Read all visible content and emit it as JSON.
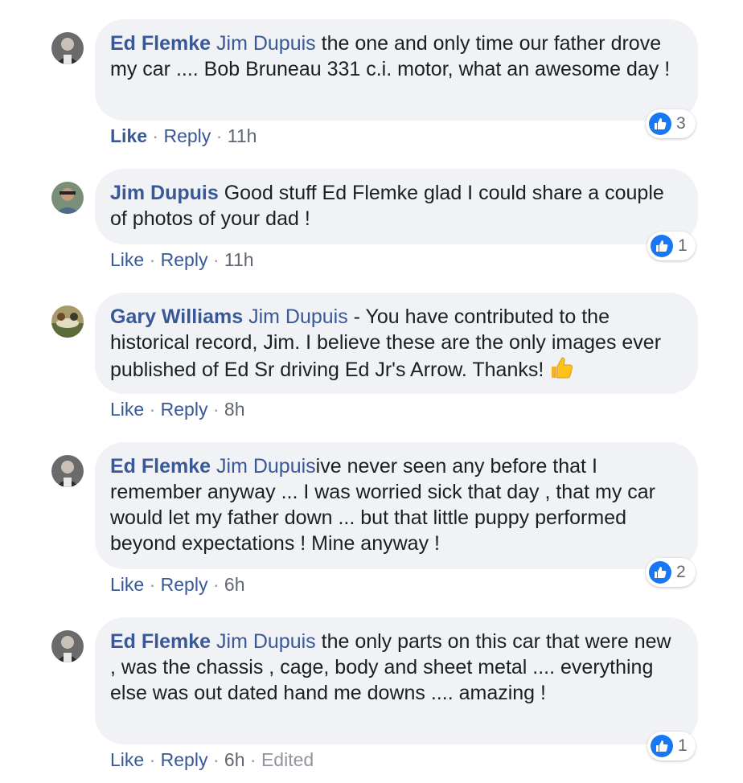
{
  "comments": [
    {
      "author": "Ed Flemke",
      "tag": "Jim Dupuis",
      "text": " the one and only time our father drove my car .... Bob Bruneau 331 c.i. motor, what an awesome day !",
      "like_label": "Like",
      "reply_label": "Reply",
      "time": "11h",
      "reactions": "3",
      "avatar": "ed-flemke-avatar"
    },
    {
      "author": "Jim Dupuis",
      "tag": "",
      "text": " Good stuff Ed Flemke glad I could share a couple of photos of your dad !",
      "like_label": "Like",
      "reply_label": "Reply",
      "time": "11h",
      "reactions": "1",
      "avatar": "jim-dupuis-avatar"
    },
    {
      "author": "Gary Williams",
      "tag": "Jim Dupuis",
      "text": " - You have contributed to the historical record, Jim. I believe these are the only images ever published of Ed Sr driving Ed Jr's Arrow. Thanks! ",
      "like_label": "Like",
      "reply_label": "Reply",
      "time": "8h",
      "reactions": "",
      "avatar": "gary-williams-avatar"
    },
    {
      "author": "Ed Flemke",
      "tag": "Jim Dupuis",
      "text": "ive never seen any before that I remember anyway ... I was worried sick that day , that my car would let my father down ... but that little puppy performed beyond expectations ! Mine anyway !",
      "like_label": "Like",
      "reply_label": "Reply",
      "time": "6h",
      "reactions": "2",
      "avatar": "ed-flemke-avatar"
    },
    {
      "author": "Ed Flemke",
      "tag": "Jim Dupuis",
      "text": " the only parts on this car that were new , was the chassis , cage, body and sheet metal .... everything else was out dated hand me downs .... amazing !",
      "like_label": "Like",
      "reply_label": "Reply",
      "time": "6h",
      "edited": "Edited",
      "reactions": "1",
      "avatar": "ed-flemke-avatar"
    }
  ],
  "dot": "·",
  "colors": {
    "link": "#385898",
    "bubble": "#f0f2f5",
    "like_blue": "#1877f2",
    "meta": "#606770"
  }
}
